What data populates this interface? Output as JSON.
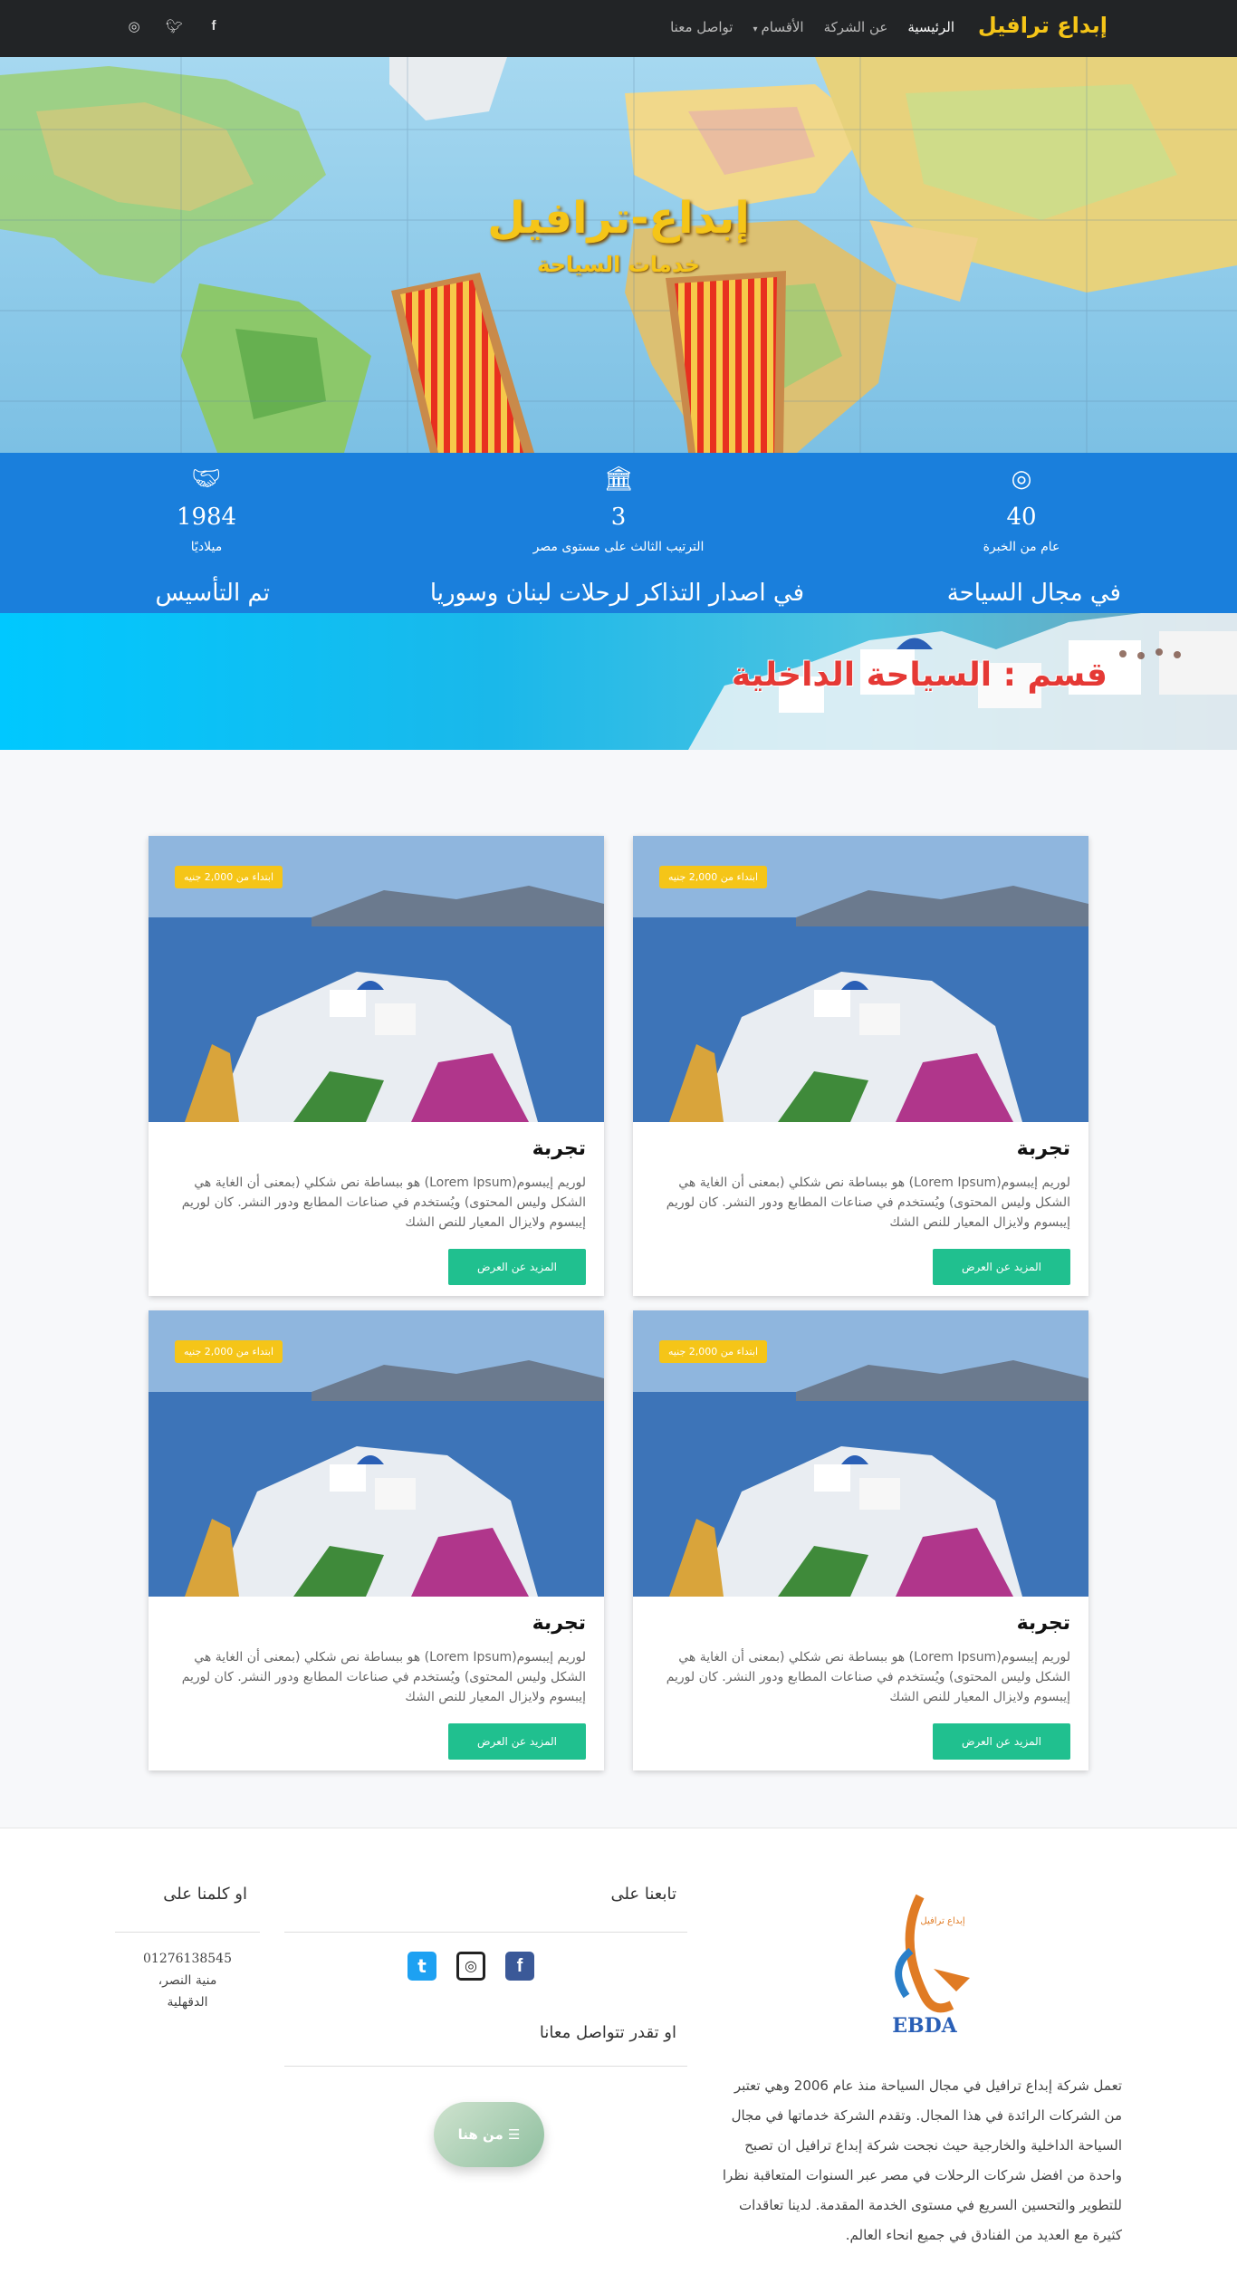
{
  "navbar": {
    "brand": "إبداع ترافيل",
    "links": [
      "الرئيسية",
      "عن الشركة",
      "الأقسام",
      "تواصل معنا"
    ],
    "active": "الرئيسية",
    "social_icons": [
      "facebook-icon",
      "twitter-icon",
      "instagram-icon"
    ]
  },
  "hero": {
    "title": "إبداع-ترافيل",
    "subtitle": "خدمات السياحة"
  },
  "stats": [
    {
      "icon": "target-icon",
      "value": "40",
      "label": "عام من الخبرة",
      "tagline": "في مجال السياحة"
    },
    {
      "icon": "bank-icon",
      "value": "3",
      "label": "الترتيب الثالث على مستوى مصر",
      "tagline": "في اصدار التذاكر لرحلات لبنان وسوريا"
    },
    {
      "icon": "handshake-icon",
      "value": "1984",
      "label": "ميلاديًا",
      "tagline": "تم التأسيس"
    }
  ],
  "section": {
    "title": "قسم : السياحة الداخلية"
  },
  "cards": [
    {
      "badge": "ابتداء من 2,000 جنيه",
      "title": "تجربة",
      "text": "لوريم إيبسوم(Lorem Ipsum) هو ببساطة نص شكلي (بمعنى أن الغاية هي الشكل وليس المحتوى) ويُستخدم في صناعات المطابع ودور النشر. كان لوريم إيبسوم ولايزال المعيار للنص الشك",
      "button": "المزيد عن العرض"
    },
    {
      "badge": "ابتداء من 2,000 جنيه",
      "title": "تجربة",
      "text": "لوريم إيبسوم(Lorem Ipsum) هو ببساطة نص شكلي (بمعنى أن الغاية هي الشكل وليس المحتوى) ويُستخدم في صناعات المطابع ودور النشر. كان لوريم إيبسوم ولايزال المعيار للنص الشك",
      "button": "المزيد عن العرض"
    },
    {
      "badge": "ابتداء من 2,000 جنيه",
      "title": "تجربة",
      "text": "لوريم إيبسوم(Lorem Ipsum) هو ببساطة نص شكلي (بمعنى أن الغاية هي الشكل وليس المحتوى) ويُستخدم في صناعات المطابع ودور النشر. كان لوريم إيبسوم ولايزال المعيار للنص الشك",
      "button": "المزيد عن العرض"
    },
    {
      "badge": "ابتداء من 2,000 جنيه",
      "title": "تجربة",
      "text": "لوريم إيبسوم(Lorem Ipsum) هو ببساطة نص شكلي (بمعنى أن الغاية هي الشكل وليس المحتوى) ويُستخدم في صناعات المطابع ودور النشر. كان لوريم إيبسوم ولايزال المعيار للنص الشك",
      "button": "المزيد عن العرض"
    }
  ],
  "footer": {
    "logo_text": "EBDA",
    "logo_label": "إبداع ترافيل",
    "about": "تعمل شركة إبداع ترافيل في مجال السياحة منذ عام 2006 وهي تعتبر من الشركات الرائدة في هذا المجال. وتقدم الشركة خدماتها في مجال السياحة الداخلية والخارجية حيث نجحت شركة إبداع ترافيل ان تصبح واحدة من افضل شركات الرحلات في مصر عبر السنوات المتعاقبة نظرا للتطوير والتحسين السريع في مستوى الخدمة المقدمة. لدينا تعاقدات كثيرة مع العديد من الفنادق في جميع انحاء العالم.",
    "follow_heading": "تابعنا على",
    "contact_heading": "او تقدر تتواصل معانا",
    "contact_button": "من هنا",
    "call_heading": "او كلمنا على",
    "phone": "01276138545",
    "address_line1": "منية النصر،",
    "address_line2": "الدقهلية"
  },
  "colors": {
    "navbar": "#222426",
    "brand": "#f5c518",
    "stats_bg": "#1a7fdc",
    "button": "#20c08f",
    "badge": "#f5c518",
    "section_title": "#e53935"
  }
}
